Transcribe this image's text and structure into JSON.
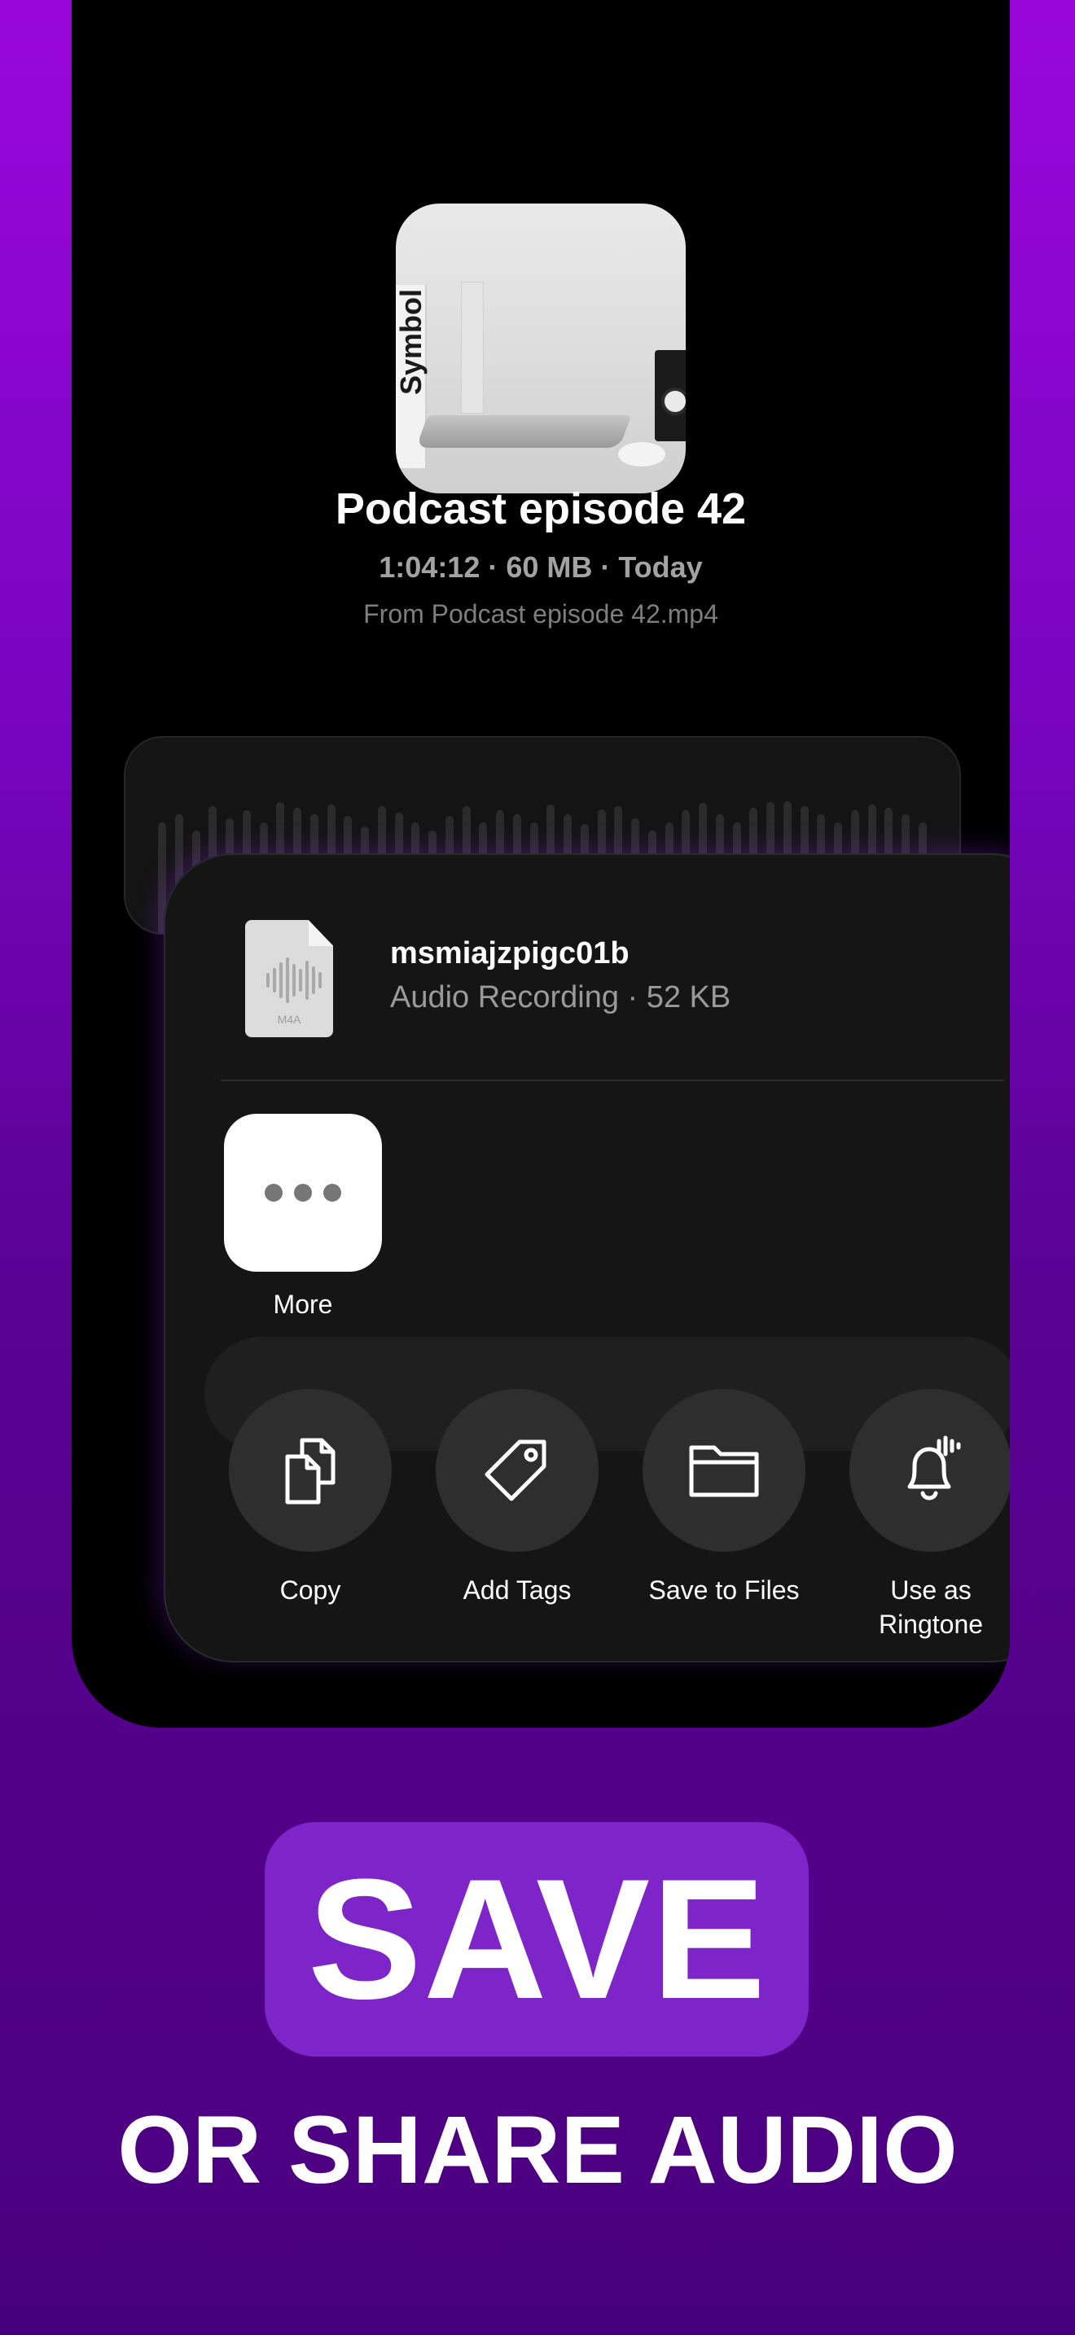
{
  "colors": {
    "background_top": "#9a07da",
    "background_bottom": "#4a007e",
    "phone_background": "#000000",
    "share_sheet_background": "#151515",
    "cta_box": "#7d25c8"
  },
  "recording": {
    "title": "Podcast episode 42",
    "meta": "1:04:12 · 60 MB · Today",
    "source": "From Podcast episode 42.mp4",
    "artwork_icon": "podcast-artwork-image",
    "artwork_box_text": "Symbol"
  },
  "share_sheet": {
    "file_icon": "m4a-file-icon",
    "file_extension": "M4A",
    "file_name": "msmiajzpigc01b",
    "file_subtitle": "Audio Recording · 52 KB",
    "more": {
      "label": "More",
      "icon": "ellipsis-icon"
    },
    "actions": [
      {
        "label": "Copy",
        "icon": "copy-icon"
      },
      {
        "label": "Add Tags",
        "icon": "tag-icon"
      },
      {
        "label": "Save to Files",
        "icon": "folder-icon"
      },
      {
        "label": "Use as\nRingtone",
        "icon": "bell-icon"
      }
    ]
  },
  "cta": {
    "headline": "SAVE",
    "subheadline": "OR SHARE AUDIO"
  }
}
